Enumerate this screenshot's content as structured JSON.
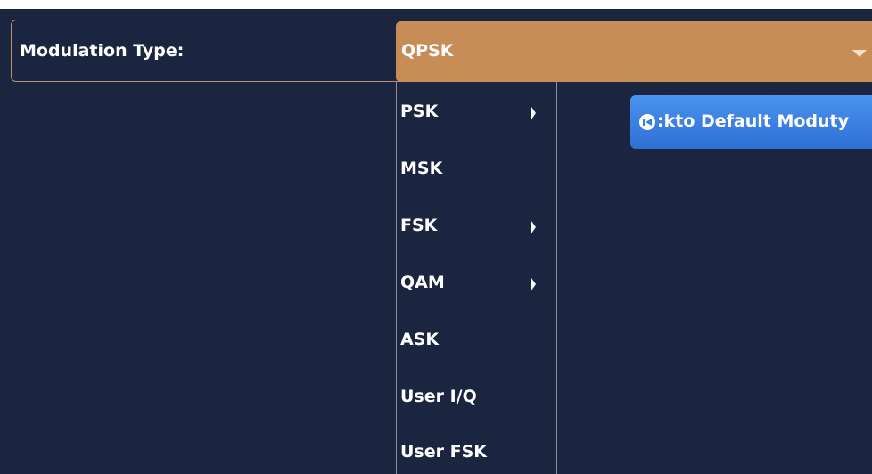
{
  "modulation": {
    "label": "Modulation Type:",
    "selected": "QPSK"
  },
  "dropdown": {
    "items": [
      {
        "label": "PSK",
        "has_submenu": true
      },
      {
        "label": "MSK",
        "has_submenu": false
      },
      {
        "label": "FSK",
        "has_submenu": true
      },
      {
        "label": "QAM",
        "has_submenu": true
      },
      {
        "label": "ASK",
        "has_submenu": false
      },
      {
        "label": "User I/Q",
        "has_submenu": false
      },
      {
        "label": "User FSK",
        "has_submenu": false
      }
    ]
  },
  "back_button": {
    "label": ":kto Default Moduty",
    "icon": "skip-back-icon"
  },
  "colors": {
    "background": "#1b2540",
    "select_accent": "#c88c56",
    "button_blue": "#3a7fe0"
  }
}
